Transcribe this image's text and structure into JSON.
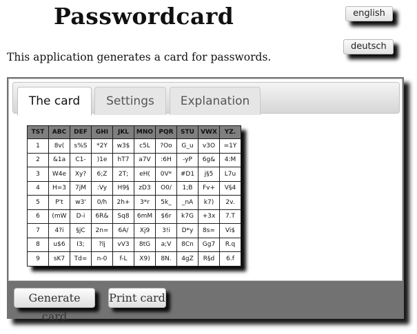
{
  "header": {
    "title": "Passwordcard",
    "lang_english": "english",
    "lang_german": "deutsch"
  },
  "intro": "This application generates a card for passwords.",
  "tabs": [
    {
      "label": "The card",
      "active": true
    },
    {
      "label": "Settings",
      "active": false
    },
    {
      "label": "Explanation",
      "active": false
    }
  ],
  "card": {
    "headers": [
      "TST",
      "ABC",
      "DEF",
      "GHI",
      "JKL",
      "MNO",
      "PQR",
      "STU",
      "VWX",
      "YZ."
    ],
    "rows": [
      [
        "1",
        "8v(",
        "s%S",
        "*2Y",
        "w3$",
        "c5L",
        "?Oo",
        "G_u",
        "v3O",
        "=1Y"
      ],
      [
        "2",
        "&1a",
        "C1-",
        ")1e",
        "hT7",
        "a7V",
        ":6H",
        "-yP",
        "6g&",
        "4:M"
      ],
      [
        "3",
        "W4e",
        "Xy?",
        "6;Z",
        "2T;",
        "eH(",
        "0V*",
        "#D1",
        "j§5",
        "L7u"
      ],
      [
        "4",
        "H=3",
        "7jM",
        ":Vy",
        "H9§",
        "zD3",
        "O0/",
        "1;B",
        "Fv+",
        "V§4"
      ],
      [
        "5",
        "P't",
        "w3'",
        "0/h",
        "2h+",
        "3*r",
        "5k_",
        "_nA",
        "k7)",
        "2v."
      ],
      [
        "6",
        "(mW",
        "D-i",
        "6R&",
        "Sq8",
        "6mM",
        "$6r",
        "k7G",
        "+3x",
        "7.T"
      ],
      [
        "7",
        "4?i",
        "§jC",
        "2n=",
        "6A/",
        "Xj9",
        "3!i",
        "D*y",
        "8s=",
        "Vi$"
      ],
      [
        "8",
        "u$6",
        "I3;",
        "?lj",
        "vV3",
        "8tG",
        "a;V",
        "8Cn",
        "Gg7",
        "R.q"
      ],
      [
        "9",
        "sK7",
        "Td=",
        "n-0",
        "f-L",
        "X9)",
        "8N.",
        "4gZ",
        "R§d",
        "6.f"
      ]
    ]
  },
  "actions": {
    "generate_label": "Generate card",
    "print_label": "Print card"
  },
  "colors": {
    "panel": "#727272",
    "card_header": "#7f7f7f"
  }
}
